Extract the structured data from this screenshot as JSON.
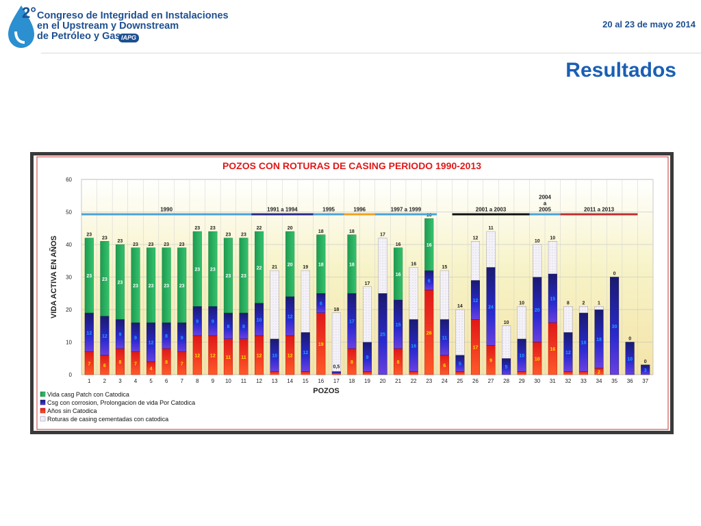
{
  "header": {
    "congress_line1": "Congreso de Integridad en Instalaciones",
    "congress_line2": "en el Upstream y Downstream",
    "congress_line3": "de Petróleo y Gas",
    "logo_number": "2°",
    "badge": "IAPG",
    "date": "20 al 23 de mayo 2014"
  },
  "slide": {
    "title": "Resultados"
  },
  "colors": {
    "green": "#22a35a",
    "navy": "#1a1a9e",
    "red": "#e01818",
    "light": "#f2f0f6",
    "header_blue": "#1d4f91",
    "title_blue": "#1a5fb4"
  },
  "chart_data": {
    "type": "bar",
    "stacked": true,
    "title": "POZOS CON ROTURAS  DE CASING  PERIODO    1990-2013",
    "xlabel": "POZOS",
    "ylabel": "VIDA ACTIVA EN AÑOS",
    "ylim": [
      0,
      60
    ],
    "yticks": [
      0,
      10,
      20,
      30,
      40,
      50,
      60
    ],
    "grid": true,
    "categories": [
      "1",
      "2",
      "3",
      "4",
      "5",
      "6",
      "7",
      "8",
      "9",
      "10",
      "11",
      "12",
      "13",
      "14",
      "15",
      "16",
      "17",
      "18",
      "19",
      "20",
      "21",
      "22",
      "23",
      "24",
      "25",
      "26",
      "27",
      "28",
      "29",
      "30",
      "31",
      "32",
      "33",
      "34",
      "35",
      "36",
      "37"
    ],
    "series": [
      {
        "name": "Años sin Catodica",
        "values": [
          7,
          6,
          8,
          7,
          4,
          8,
          7,
          12,
          12,
          11,
          11,
          12,
          1,
          12,
          1,
          19,
          0.5,
          8,
          1,
          0,
          8,
          1,
          26,
          6,
          1,
          17,
          9,
          0,
          1,
          10,
          16,
          1,
          1,
          2,
          0,
          0,
          0
        ]
      },
      {
        "name": "Csg  con corrosion, Prolongacion  de vida Por  Catodica",
        "values": [
          12,
          12,
          9,
          9,
          12,
          8,
          9,
          9,
          9,
          8,
          8,
          10,
          10,
          12,
          12,
          6,
          0.5,
          17,
          9,
          25,
          15,
          16,
          6,
          11,
          5,
          12,
          24,
          5,
          10,
          20,
          15,
          12,
          18,
          18,
          30,
          10,
          3
        ]
      },
      {
        "name": "Vida casg Patch con Catodica",
        "values": [
          23,
          23,
          23,
          23,
          23,
          23,
          23,
          23,
          23,
          23,
          23,
          22,
          0,
          20,
          0,
          18,
          0,
          18,
          0,
          0,
          16,
          0,
          16,
          0,
          0,
          0,
          0,
          0,
          0,
          0,
          0,
          0,
          0,
          0,
          0,
          0,
          0
        ]
      },
      {
        "name": "Roturas de casing  cementadas con catodica",
        "values": [
          0,
          0,
          0,
          0,
          0,
          0,
          0,
          0,
          0,
          0,
          0,
          0,
          21,
          0,
          19,
          0,
          18,
          0,
          17,
          17,
          0,
          16,
          0,
          15,
          14,
          12,
          11,
          10,
          10,
          10,
          10,
          8,
          2,
          1,
          0,
          0,
          0
        ]
      }
    ],
    "top_labels": [
      "23",
      "23",
      "23",
      "23",
      "23",
      "23",
      "23",
      "23",
      "23",
      "23",
      "23",
      "22",
      "21",
      "20",
      "19",
      "18",
      "18",
      "18",
      "17",
      "17",
      "16",
      "16",
      "16",
      "15",
      "14",
      "12",
      "11",
      "10",
      "10",
      "10",
      "10",
      "8",
      "2",
      "1",
      "0",
      "0",
      "0"
    ],
    "extra_labels": [
      {
        "category": "17",
        "text": "0,5"
      }
    ],
    "periods": [
      {
        "label": "1990",
        "from": 1,
        "to": 11,
        "color": "#4aa3d6"
      },
      {
        "label": "1991 a 1994",
        "from": 12,
        "to": 15,
        "color": "#2a2a8a"
      },
      {
        "label": "1995",
        "from": 16,
        "to": 17,
        "color": "#4aa3d6"
      },
      {
        "label": "1996",
        "from": 18,
        "to": 19,
        "color": "#f0a020"
      },
      {
        "label": "1997 a 1999",
        "from": 20,
        "to": 23,
        "color": "#4aa3d6"
      },
      {
        "label": "2001 a 2003",
        "from": 25,
        "to": 29,
        "color": "#111111"
      },
      {
        "label": "2004\na\n2005",
        "from": 30,
        "to": 31,
        "color": "#4aa3d6"
      },
      {
        "label": "2011 a 2013",
        "from": 32,
        "to": 36,
        "color": "#c03030"
      }
    ],
    "legend_position": "bottom-left"
  }
}
